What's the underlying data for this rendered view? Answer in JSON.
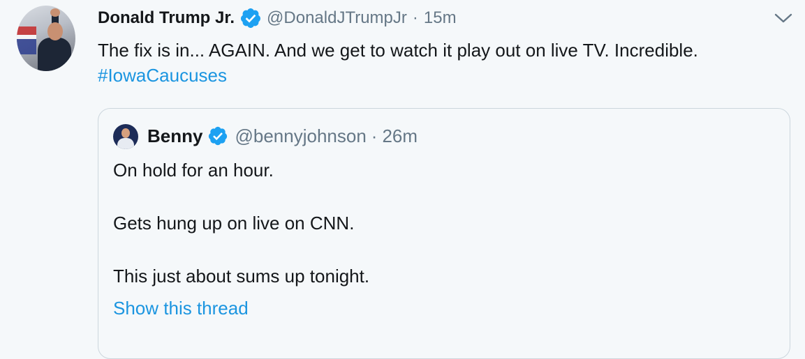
{
  "tweet": {
    "author_name": "Donald Trump Jr.",
    "handle": "@DonaldJTrumpJr",
    "separator": "·",
    "time": "15m",
    "text": "The fix is in... AGAIN. And we get to watch it play out on live TV. Incredible.",
    "hashtag": "#IowaCaucuses"
  },
  "quoted_tweet": {
    "author_name": "Benny",
    "handle": "@bennyjohnson",
    "separator": "·",
    "time": "26m",
    "lines": [
      "On hold for an hour.",
      "Gets hung up on live on CNN.",
      "This just about sums up tonight."
    ],
    "show_thread_label": "Show this thread"
  },
  "colors": {
    "background": "#f5f8fa",
    "text": "#14171a",
    "secondary_text": "#657786",
    "link": "#1b95e0",
    "verified_badge": "#1da1f2",
    "border": "#ccd6dd"
  },
  "icons": {
    "verified": "verified-badge-icon",
    "menu": "chevron-down-icon"
  }
}
